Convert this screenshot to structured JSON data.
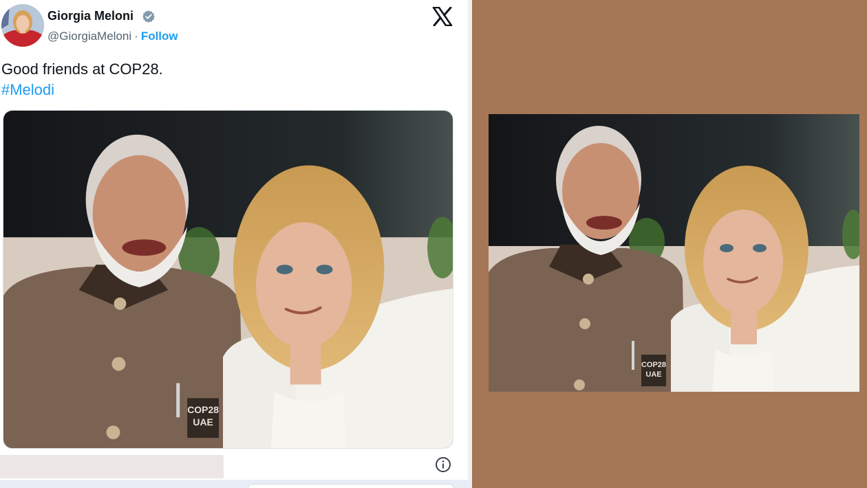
{
  "tweet": {
    "author_name": "Giorgia Meloni",
    "handle": "@GiorgiaMeloni",
    "separator": "·",
    "follow_label": "Follow",
    "text_line": "Good friends at COP28.",
    "hashtag": "#Melodi",
    "photo_badge_line1": "COP28",
    "photo_badge_line2": "UAE"
  },
  "icons": {
    "verified": "verified-badge-icon",
    "platform_logo": "x-logo-icon",
    "info": "info-icon"
  },
  "colors": {
    "link_blue": "#1d9bf0",
    "verified_grey": "#829aab",
    "panel_brown": "#a67757",
    "text_dark": "#0f1419",
    "text_muted": "#536471"
  }
}
